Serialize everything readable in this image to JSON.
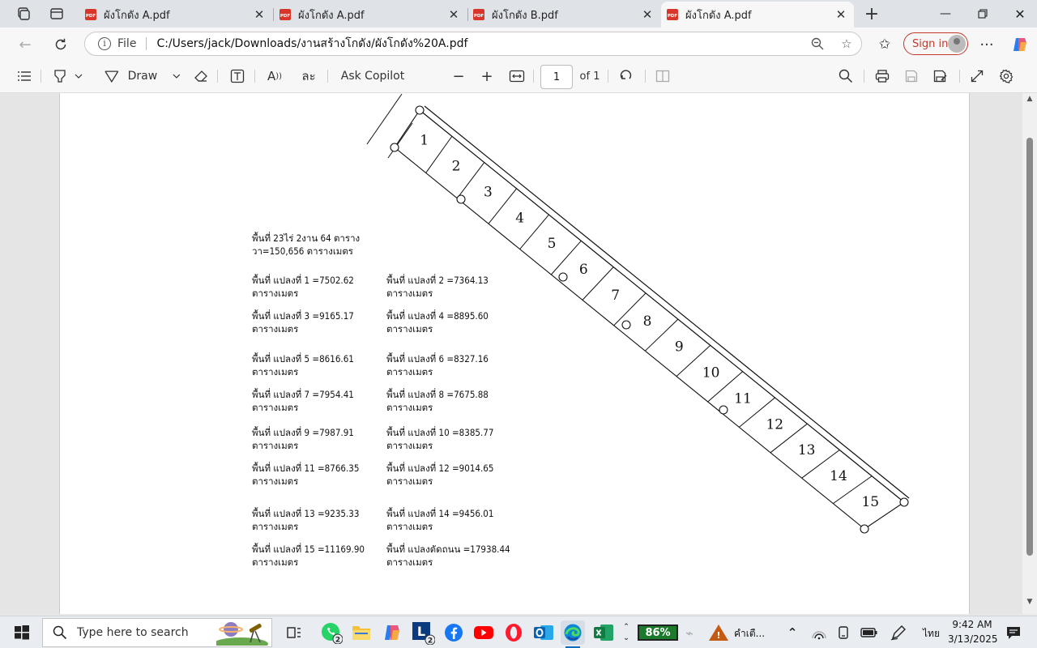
{
  "tabs": [
    {
      "title": "ผังโกดัง A.pdf",
      "active": false
    },
    {
      "title": "ผังโกดัง A.pdf",
      "active": false
    },
    {
      "title": "ผังโกดัง B.pdf",
      "active": false
    },
    {
      "title": "ผังโกดัง A.pdf",
      "active": true
    }
  ],
  "address": {
    "file_label": "File",
    "url": "C:/Users/jack/Downloads/งานสร้างโกดัง/ผังโกดัง%20A.pdf"
  },
  "signin_label": "Sign in",
  "pdf_toolbar": {
    "draw_label": "Draw",
    "ask_copilot": "Ask Copilot",
    "page_number": "1",
    "page_total": "of 1"
  },
  "document": {
    "total_line1": "พื้นที่ 23ไร่ 2งาน 64 ตาราง",
    "total_line2": "วา=150,656 ตารางเมตร",
    "unit": "ตารางเมตร",
    "plots": [
      {
        "label": "พื้นที่ แปลงที่ 1 =7502.62"
      },
      {
        "label": "พื้นที่ แปลงที่ 2 =7364.13"
      },
      {
        "label": "พื้นที่ แปลงที่ 3 =9165.17"
      },
      {
        "label": "พื้นที่ แปลงที่ 4 =8895.60"
      },
      {
        "label": "พื้นที่ แปลงที่ 5 =8616.61"
      },
      {
        "label": "พื้นที่ แปลงที่ 6 =8327.16"
      },
      {
        "label": "พื้นที่ แปลงที่ 7 =7954.41"
      },
      {
        "label": "พื้นที่ แปลงที่ 8 =7675.88"
      },
      {
        "label": "พื้นที่ แปลงที่ 9 =7987.91"
      },
      {
        "label": "พื้นที่ แปลงที่ 10 =8385.77"
      },
      {
        "label": "พื้นที่ แปลงที่ 11 =8766.35"
      },
      {
        "label": "พื้นที่ แปลงที่ 12 =9014.65"
      },
      {
        "label": "พื้นที่ แปลงที่ 13 =9235.33"
      },
      {
        "label": "พื้นที่ แปลงที่ 14 =9456.01"
      },
      {
        "label": "พื้นที่ แปลงที่ 15 =11169.90"
      },
      {
        "label": "พื้นที่ แปลงตัดถนน =17938.44"
      }
    ],
    "plot_numbers": [
      "1",
      "2",
      "3",
      "4",
      "5",
      "6",
      "7",
      "8",
      "9",
      "10",
      "11",
      "12",
      "13",
      "14",
      "15"
    ]
  },
  "taskbar": {
    "search_placeholder": "Type here to search",
    "whatsapp_badge": "2",
    "line_badge": "2",
    "battery": "86%",
    "weather_text": "คำเตื...",
    "language": "ไทย",
    "time": "9:42 AM",
    "date": "3/13/2025"
  },
  "colors": {
    "accent": "#0f6cbd",
    "signin": "#c0392b",
    "pdf_icon": "#d9362b",
    "battery_bg": "#1c7a2c"
  }
}
